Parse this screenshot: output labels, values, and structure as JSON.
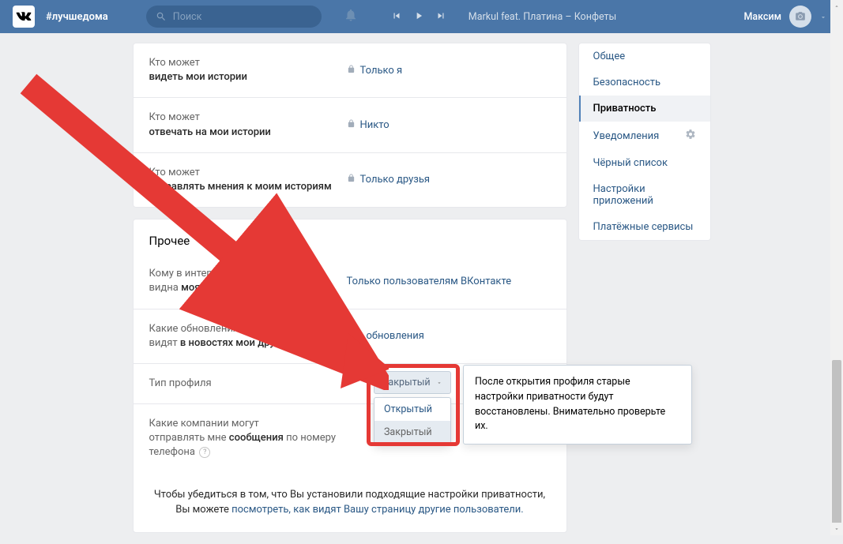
{
  "header": {
    "hashtag": "#лучшедома",
    "search_placeholder": "Поиск",
    "track": "Markul feat. Платина – Конфеты",
    "user": "Максим"
  },
  "settings": {
    "rows1": [
      {
        "pre": "Кто может",
        "bold": "видеть мои истории",
        "value": "Только я",
        "lock": true
      },
      {
        "pre": "Кто может",
        "bold": "отвечать на мои истории",
        "value": "Никто",
        "lock": true
      },
      {
        "pre": "Кто может",
        "bold": "отправлять мнения к моим историям",
        "value": "Только друзья",
        "lock": true
      }
    ],
    "section_title": "Прочее",
    "rows2": [
      {
        "pre": "Кому в интернете",
        "post": "видна",
        "bold": "моя страница",
        "value": "Только пользователям ВКонтакте"
      },
      {
        "pre": "Какие обновления",
        "post": "видят",
        "bold": "в новостях мои друзья",
        "value": "Все обновления"
      },
      {
        "label": "Тип профиля",
        "value": ""
      },
      {
        "pre": "Какие компании могут",
        "post": "отправлять мне",
        "bold": "сообщения",
        "tail": " по номеру телефона",
        "help": true,
        "value": ""
      }
    ],
    "footer_pre": "Чтобы убедиться в том, что Вы установили подходящие настройки приватности,",
    "footer_pre2": "Вы можете ",
    "footer_link": "посмотреть, как видят Вашу страницу другие пользователи."
  },
  "dropdown": {
    "selected": "Закрытый",
    "options": [
      "Открытый",
      "Закрытый"
    ]
  },
  "tooltip": "После открытия профиля старые настройки приватности будут восстановлены. Внимательно проверьте их.",
  "sidebar": {
    "items": [
      "Общее",
      "Безопасность",
      "Приватность",
      "Уведомления",
      "Чёрный список",
      "Настройки приложений",
      "Платёжные сервисы"
    ],
    "active_index": 2,
    "gear_index": 3
  }
}
